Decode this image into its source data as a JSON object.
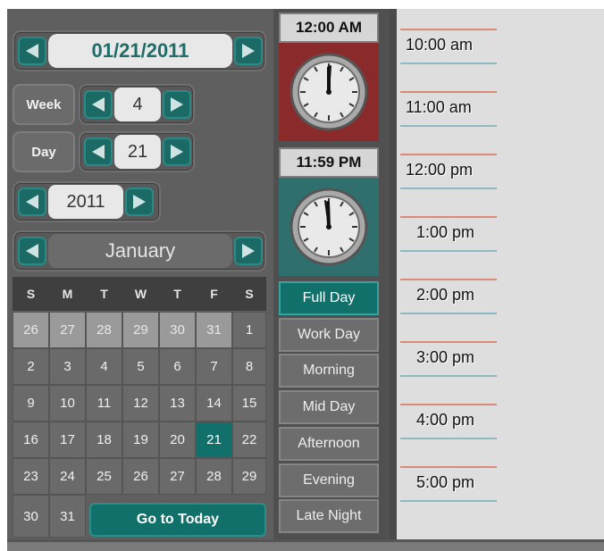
{
  "date_picker": {
    "date_value": "01/21/2011",
    "week_label": "Week",
    "week_value": "4",
    "day_label": "Day",
    "day_value": "21",
    "year_value": "2011",
    "month_value": "January"
  },
  "calendar": {
    "weekdays": [
      "S",
      "M",
      "T",
      "W",
      "T",
      "F",
      "S"
    ],
    "weeks": [
      [
        "26",
        "27",
        "28",
        "29",
        "30",
        "31",
        "1"
      ],
      [
        "2",
        "3",
        "4",
        "5",
        "6",
        "7",
        "8"
      ],
      [
        "9",
        "10",
        "11",
        "12",
        "13",
        "14",
        "15"
      ],
      [
        "16",
        "17",
        "18",
        "19",
        "20",
        "21",
        "22"
      ],
      [
        "23",
        "24",
        "25",
        "26",
        "27",
        "28",
        "29"
      ],
      [
        "30",
        "31"
      ]
    ],
    "selected_day": "21",
    "go_to_today_label": "Go to Today"
  },
  "time_range": {
    "start_label": "12:00 AM",
    "end_label": "11:59 PM",
    "start_color": "#8a2a2a",
    "end_color": "#2f6f6d"
  },
  "presets": [
    "Full Day",
    "Work Day",
    "Morning",
    "Mid Day",
    "Afternoon",
    "Evening",
    "Late Night"
  ],
  "active_preset": "Full Day",
  "schedule": {
    "slots": [
      "10:00 am",
      "11:00 am",
      "12:00 pm",
      "1:00 pm",
      "2:00 pm",
      "3:00 pm",
      "4:00 pm",
      "5:00 pm"
    ]
  },
  "icons": {
    "prev": "left-arrow-icon",
    "next": "right-arrow-icon",
    "clock": "clock-icon"
  },
  "colors": {
    "accent": "#12706b"
  }
}
